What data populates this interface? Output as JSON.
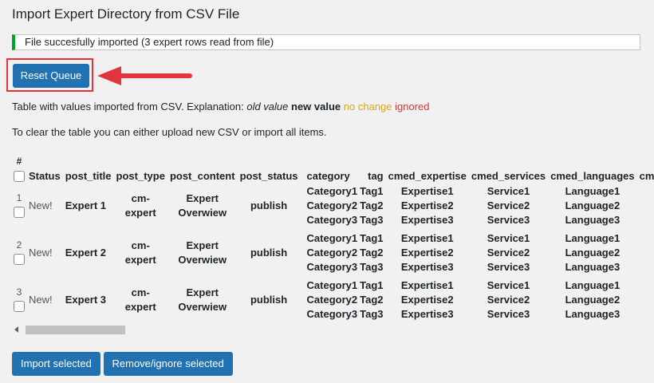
{
  "page": {
    "title": "Import Expert Directory from CSV File",
    "notice": "File succesfully imported (3 expert rows read from file)",
    "reset_label": "Reset Queue",
    "explain": {
      "prefix": "Table with values imported from CSV. Explanation: ",
      "old_value": "old value",
      "new_value": "new value",
      "no_change": "no change",
      "ignored": "ignored"
    },
    "clear_note": "To clear the table you can either upload new CSV or import all items.",
    "import_label": "Import selected",
    "remove_label": "Remove/ignore selected"
  },
  "colors": {
    "primary_button": "#2271b1",
    "success_border": "#00a32a",
    "highlight_red": "#e2343a",
    "no_change": "#dba617",
    "ignored": "#d63638"
  },
  "table": {
    "hash": "#",
    "columns": [
      "Status",
      "post_title",
      "post_type",
      "post_content",
      "post_status",
      "category",
      "tag",
      "cmed_expertise",
      "cmed_services",
      "cmed_languages",
      "cmed_taxo"
    ],
    "rows": [
      {
        "num": "1",
        "status": "New!",
        "post_title": "Expert 1",
        "post_type": [
          "cm-",
          "expert"
        ],
        "post_content": [
          "Expert",
          "Overwiew"
        ],
        "post_status": "publish",
        "category": [
          "Category1",
          "Category2",
          "Category3"
        ],
        "tag": [
          "Tag1",
          "Tag2",
          "Tag3"
        ],
        "expertise": [
          "Expertise1",
          "Expertise2",
          "Expertise3"
        ],
        "services": [
          "Service1",
          "Service2",
          "Service3"
        ],
        "languages": [
          "Language1",
          "Language2",
          "Language3"
        ]
      },
      {
        "num": "2",
        "status": "New!",
        "post_title": "Expert 2",
        "post_type": [
          "cm-",
          "expert"
        ],
        "post_content": [
          "Expert",
          "Overwiew"
        ],
        "post_status": "publish",
        "category": [
          "Category1",
          "Category2",
          "Category3"
        ],
        "tag": [
          "Tag1",
          "Tag2",
          "Tag3"
        ],
        "expertise": [
          "Expertise1",
          "Expertise2",
          "Expertise3"
        ],
        "services": [
          "Service1",
          "Service2",
          "Service3"
        ],
        "languages": [
          "Language1",
          "Language2",
          "Language3"
        ]
      },
      {
        "num": "3",
        "status": "New!",
        "post_title": "Expert 3",
        "post_type": [
          "cm-",
          "expert"
        ],
        "post_content": [
          "Expert",
          "Overwiew"
        ],
        "post_status": "publish",
        "category": [
          "Category1",
          "Category2",
          "Category3"
        ],
        "tag": [
          "Tag1",
          "Tag2",
          "Tag3"
        ],
        "expertise": [
          "Expertise1",
          "Expertise2",
          "Expertise3"
        ],
        "services": [
          "Service1",
          "Service2",
          "Service3"
        ],
        "languages": [
          "Language1",
          "Language2",
          "Language3"
        ]
      }
    ]
  }
}
